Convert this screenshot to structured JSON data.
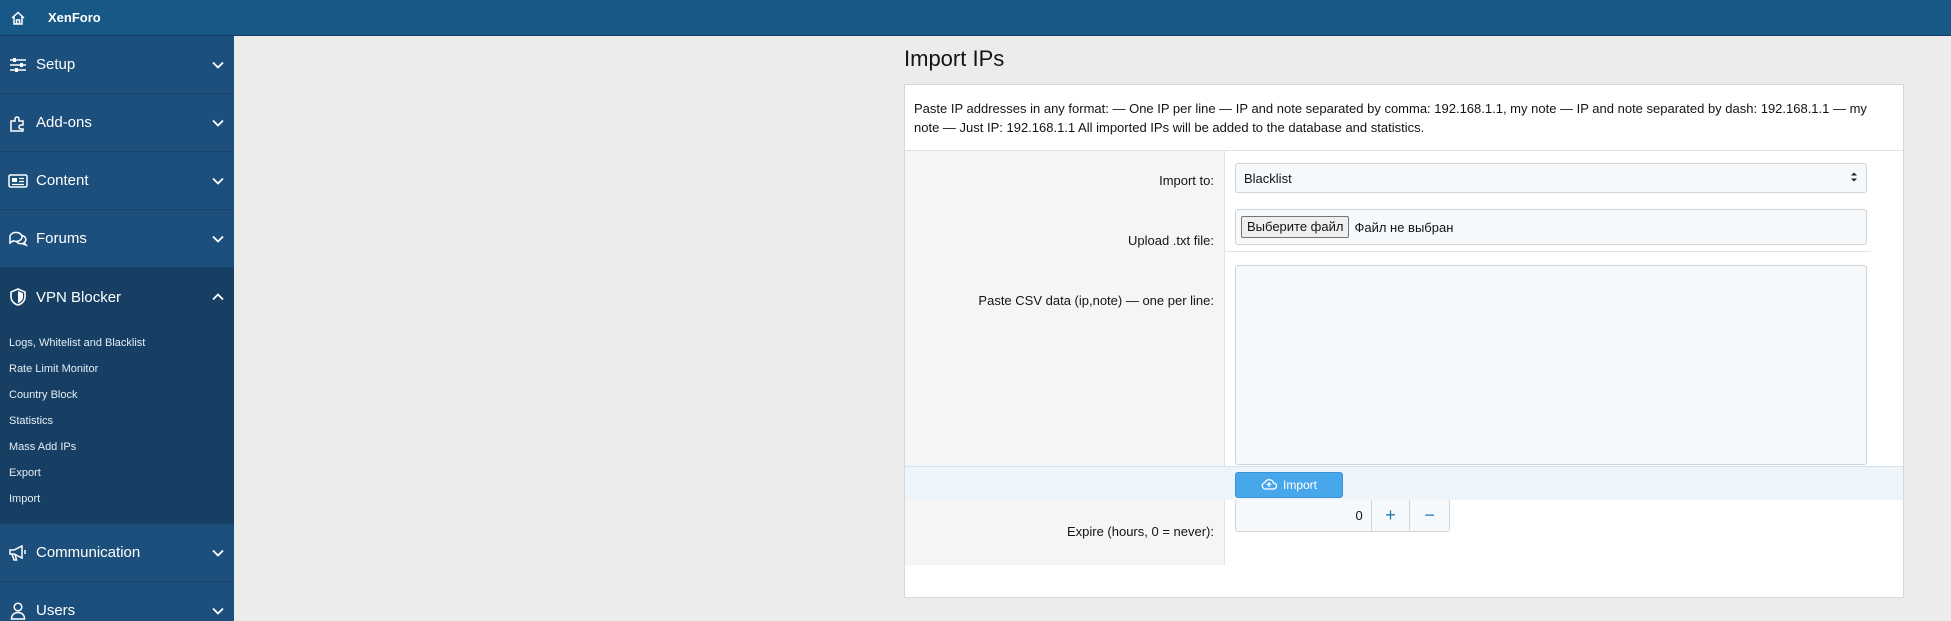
{
  "app": {
    "brand": "XenForo"
  },
  "sidebar": {
    "sections": [
      {
        "label": "Setup",
        "icon": "sliders-icon",
        "expanded": false
      },
      {
        "label": "Add-ons",
        "icon": "puzzle-icon",
        "expanded": false
      },
      {
        "label": "Content",
        "icon": "newspaper-icon",
        "expanded": false
      },
      {
        "label": "Forums",
        "icon": "comments-icon",
        "expanded": false
      },
      {
        "label": "VPN Blocker",
        "icon": "shield-icon",
        "expanded": true
      },
      {
        "label": "Communication",
        "icon": "megaphone-icon",
        "expanded": false
      },
      {
        "label": "Users",
        "icon": "user-icon",
        "expanded": false
      }
    ],
    "subitems": [
      "Logs, Whitelist and Blacklist",
      "Rate Limit Monitor",
      "Country Block",
      "Statistics",
      "Mass Add IPs",
      "Export",
      "Import"
    ]
  },
  "page": {
    "title": "Import IPs",
    "explain": "Paste IP addresses in any format: — One IP per line — IP and note separated by comma: 192.168.1.1, my note — IP and note separated by dash: 192.168.1.1 — my note — Just IP: 192.168.1.1 All imported IPs will be added to the database and statistics.",
    "import_to": {
      "label": "Import to:",
      "value": "Blacklist"
    },
    "upload": {
      "label": "Upload .txt file:",
      "button": "Выберите файл",
      "status": "Файл не выбран"
    },
    "csv": {
      "label": "Paste CSV data (ip,note) — one per line:",
      "value": ""
    },
    "expire": {
      "label": "Expire (hours, 0 = never):",
      "value": "0",
      "plus": "+",
      "minus": "−"
    },
    "submit": "Import"
  },
  "colors": {
    "topbar": "#185886",
    "sidebar": "#1c4f7c",
    "sidebar_active": "#163f63",
    "button": "#47a7eb",
    "background": "#ececec"
  }
}
